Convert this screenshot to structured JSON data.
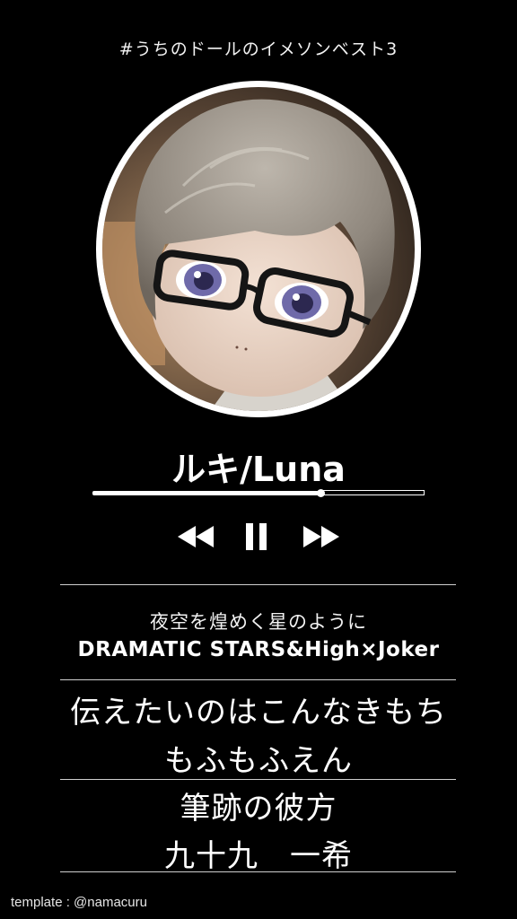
{
  "header": {
    "hashtag": "#うちのドールのイメソンベスト3"
  },
  "avatar": {
    "subject": "doll photo"
  },
  "player": {
    "title": "ルキ/Luna",
    "progress": 0.69,
    "controls": {
      "rewind_icon": "rewind-icon",
      "pause_icon": "pause-icon",
      "forward_icon": "fast-forward-icon"
    }
  },
  "song1": {
    "title": "夜空を煌めく星のように",
    "artist": "DRAMATIC STARS&High×Joker"
  },
  "song2": {
    "title": "伝えたいのはこんなきもち",
    "artist": "もふもふえん"
  },
  "song3": {
    "title": "筆跡の彼方",
    "artist": "九十九　一希"
  },
  "footer": {
    "credit": "template : @namacuru"
  },
  "colors": {
    "background": "#000000",
    "foreground": "#ffffff"
  }
}
